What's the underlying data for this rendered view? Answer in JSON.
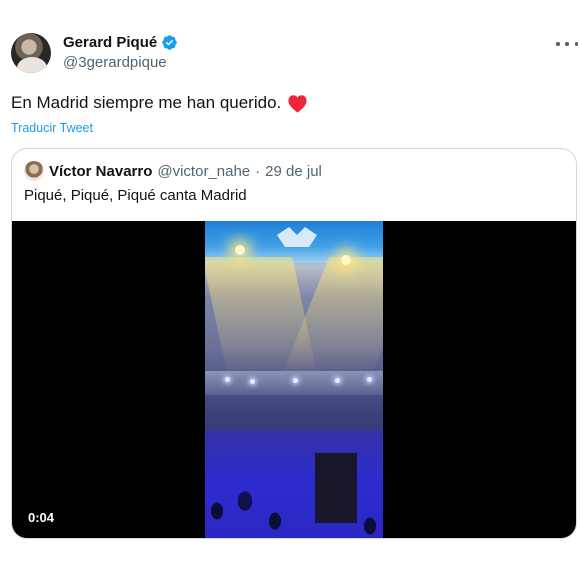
{
  "tweet": {
    "author_name": "Gerard Piqué",
    "author_handle": "@3gerardpique",
    "text": "En Madrid siempre me han querido.",
    "translate_label": "Traducir Tweet",
    "icons": [
      "avatar",
      "verified-badge-icon",
      "more-options-icon",
      "red-heart-emoji-icon"
    ],
    "colors": {
      "link": "#1d9bf0",
      "verified": "#1d9bf0",
      "heart": "#f0243a",
      "secondary_text": "#536471"
    }
  },
  "quote": {
    "author_name": "Víctor Navarro",
    "author_handle": "@victor_nahe",
    "separator": "·",
    "date": "29 de jul",
    "text": "Piqué, Piqué, Piqué canta Madrid",
    "video": {
      "duration": "0:04"
    }
  }
}
